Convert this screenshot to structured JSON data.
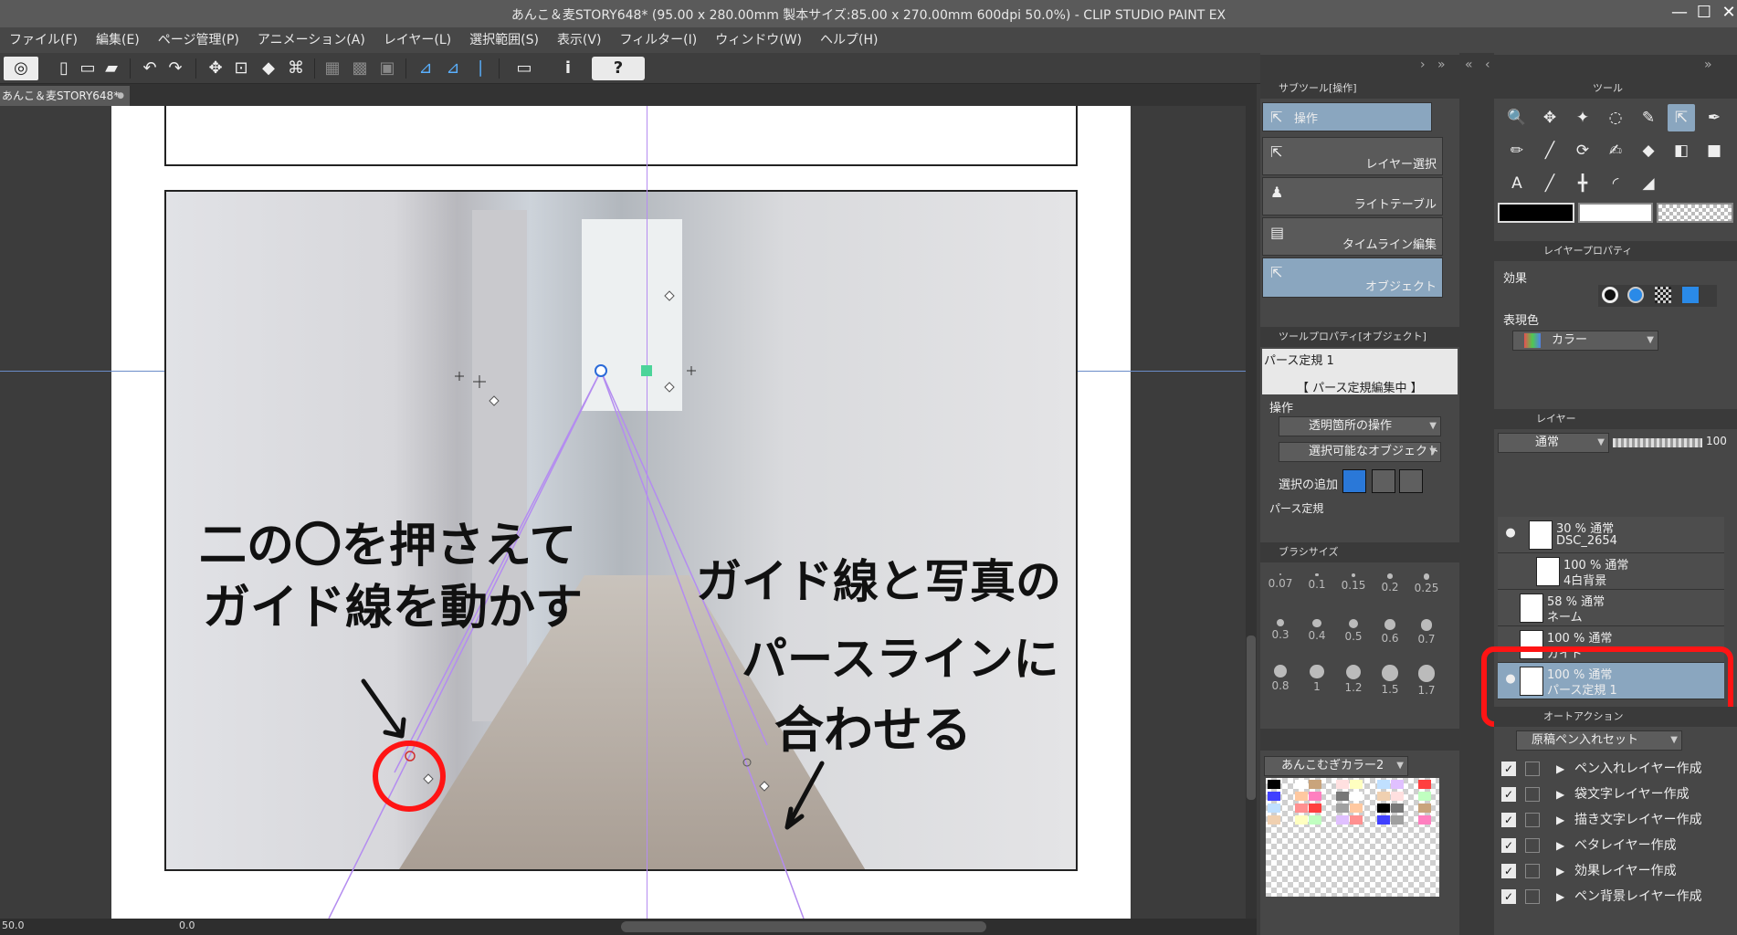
{
  "window": {
    "title": "あんこ＆麦STORY648* (95.00 x 280.00mm 製本サイズ:85.00 x 270.00mm 600dpi 50.0%) - CLIP STUDIO PAINT EX",
    "minimize": "—",
    "maximize": "☐",
    "close": "✕"
  },
  "menu": [
    "ファイル(F)",
    "編集(E)",
    "ページ管理(P)",
    "アニメーション(A)",
    "レイヤー(L)",
    "選択範囲(S)",
    "表示(V)",
    "フィルター(I)",
    "ウィンドウ(W)",
    "ヘルプ(H)"
  ],
  "toolbar": {
    "icons": [
      "app-logo-icon",
      "new-file-icon",
      "open-file-icon",
      "save-icon",
      "undo-icon",
      "redo-icon",
      "clear-icon",
      "fill-icon",
      "transform-icon",
      "hide-selection-icon",
      "snap-ruler-icon",
      "snap-perspective-icon",
      "snap-special-ruler-icon",
      "color-icon",
      "info-icon",
      "help-icon"
    ],
    "glyphs": [
      "◎",
      "▯",
      "▭",
      "▰",
      "↶",
      "↷",
      "✥",
      "⊡",
      "◆",
      "⌘",
      "▦",
      "▩",
      "▣",
      "⊿",
      "⊿",
      "∣",
      "▭",
      "i",
      "?"
    ]
  },
  "document_tab": {
    "label": "あんこ＆麦STORY648*",
    "close": "●"
  },
  "canvas": {
    "annotation_left_1": "二の〇を押さえて",
    "annotation_left_2": "ガイド線を動かす",
    "annotation_right_1": "ガイド線と写真の",
    "annotation_right_2": "パースラインに",
    "annotation_right_3": "合わせる",
    "annotation_color": "#111111",
    "highlight_color": "#ff1414",
    "arrow_color": "#111111"
  },
  "statusbar": {
    "zoom": "50.0",
    "rotation": "0.0"
  },
  "subtool_panel": {
    "header": "サブツール[操作]",
    "group_label": "操作",
    "items": [
      {
        "label": "レイヤー選択",
        "icon": "layer-select-icon",
        "glyph": "⇱"
      },
      {
        "label": "ライトテーブル",
        "icon": "light-table-icon",
        "glyph": "♟"
      },
      {
        "label": "タイムライン編集",
        "icon": "timeline-icon",
        "glyph": "▤"
      },
      {
        "label": "オブジェクト",
        "icon": "object-icon",
        "glyph": "⇱"
      }
    ]
  },
  "tool_property_panel": {
    "header": "ツールプロパティ[オブジェクト]",
    "target": "パース定規 1",
    "status": "【 パース定規編集中 】",
    "section": "操作",
    "transparent_op": "透明箇所の操作",
    "selectable_obj": "選択可能なオブジェクト",
    "add_selection_label": "選択の追加",
    "footer_label": "パース定規"
  },
  "brush_size_panel": {
    "header": "ブラシサイズ",
    "sizes": [
      "0.07",
      "0.1",
      "0.15",
      "0.2",
      "0.25",
      "0.3",
      "0.4",
      "0.5",
      "0.6",
      "0.7",
      "0.8",
      "1",
      "1.2",
      "1.5",
      "1.7"
    ]
  },
  "color_set_panel": {
    "set_name": "あんこむぎカラー2"
  },
  "tools_panel": {
    "header": "ツール",
    "tools": [
      {
        "icon": "zoom-icon",
        "glyph": "🔍"
      },
      {
        "icon": "move-icon",
        "glyph": "✥"
      },
      {
        "icon": "auto-select-icon",
        "glyph": "✦"
      },
      {
        "icon": "lasso-icon",
        "glyph": "◌"
      },
      {
        "icon": "eyedropper-icon",
        "glyph": "✎"
      },
      {
        "icon": "operation-icon",
        "glyph": "⇱"
      },
      {
        "icon": "pen-icon",
        "glyph": "✒"
      },
      {
        "icon": "pencil-icon",
        "glyph": "✏"
      },
      {
        "icon": "brush-icon",
        "glyph": "╱"
      },
      {
        "icon": "airbrush-icon",
        "glyph": "⟳"
      },
      {
        "icon": "decoration-icon",
        "glyph": "✍"
      },
      {
        "icon": "eraser-icon",
        "glyph": "◆"
      },
      {
        "icon": "fill-bucket-icon",
        "glyph": "◧"
      },
      {
        "icon": "gradient-icon",
        "glyph": "■"
      },
      {
        "icon": "text-icon",
        "glyph": "A"
      },
      {
        "icon": "line-icon",
        "glyph": "╱"
      },
      {
        "icon": "ruler-icon",
        "glyph": "╋"
      },
      {
        "icon": "balloon-icon",
        "glyph": "◜"
      },
      {
        "icon": "correct-line-icon",
        "glyph": "◢"
      }
    ],
    "main_color": "#000000",
    "sub_color": "#ffffff"
  },
  "layer_property_panel": {
    "header": "レイヤープロパティ",
    "effect_label": "効果",
    "expression_label": "表現色",
    "expression_value": "カラー"
  },
  "layer_panel": {
    "header": "レイヤー",
    "blend_mode": "通常",
    "opacity": "100",
    "layers": [
      {
        "opacity_mode": "30 % 通常",
        "name": "DSC_2654",
        "visible": true,
        "selected": false
      },
      {
        "opacity_mode": "100 % 通常",
        "name": "4白背景",
        "visible": false,
        "selected": false
      },
      {
        "opacity_mode": "58 % 通常",
        "name": "ネーム",
        "visible": false,
        "selected": false
      },
      {
        "opacity_mode": "100 % 通常",
        "name": "ガイド",
        "visible": false,
        "selected": false
      },
      {
        "opacity_mode": "100 % 通常",
        "name": "パース定規 1",
        "visible": true,
        "selected": true
      }
    ]
  },
  "auto_action_panel": {
    "header": "オートアクション",
    "set_name": "原稿ペン入れセット",
    "actions": [
      {
        "label": "ペン入れレイヤー作成",
        "checked": true
      },
      {
        "label": "袋文字レイヤー作成",
        "checked": true
      },
      {
        "label": "描き文字レイヤー作成",
        "checked": true
      },
      {
        "label": "ベタレイヤー作成",
        "checked": true
      },
      {
        "label": "効果レイヤー作成",
        "checked": true
      },
      {
        "label": "ペン背景レイヤー作成",
        "checked": true
      }
    ]
  }
}
